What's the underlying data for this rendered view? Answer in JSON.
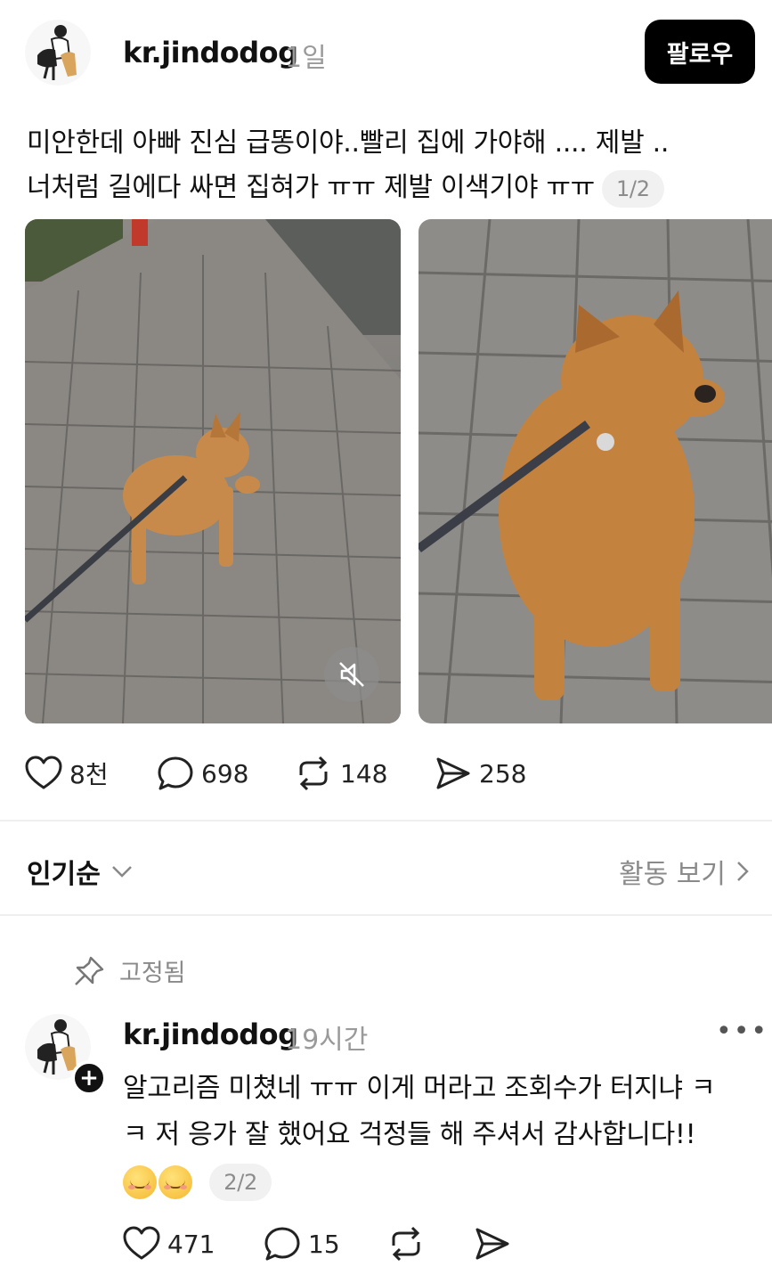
{
  "post": {
    "username": "kr.jindodog",
    "time": "1일",
    "follow_label": "팔로우",
    "text_line1": "미안한데 아빠 진심 급똥이야..빨리 집에 가야해 .... 제발 ..",
    "text_line2": "너처럼 길에다 싸면 집혀가 ㅠㅠ 제발 이색기야 ㅠㅠ",
    "counter": "1/2",
    "stats": {
      "likes": "8천",
      "comments": "698",
      "reposts": "148",
      "shares": "258"
    }
  },
  "replies_header": {
    "sort_label": "인기순",
    "activity_label": "활동 보기"
  },
  "comment": {
    "pinned_label": "고정됨",
    "username": "kr.jindodog",
    "time": "19시간",
    "more": "•••",
    "text_line1": "알고리즘 미쳤네 ㅠㅠ 이게 머라고 조회수가 터지냐 ㅋ",
    "text_line2": "ㅋ 저 응가 잘 했어요 걱정들 해 주셔서 감사합니다!!",
    "counter": "2/2",
    "stats": {
      "likes": "471",
      "comments": "15"
    }
  },
  "icons": {
    "like": "heart-icon",
    "comment": "speech-bubble-icon",
    "repost": "repost-icon",
    "share": "send-icon",
    "mute": "speaker-muted-icon",
    "pin": "pin-icon",
    "sort": "chevron-down-icon",
    "activity": "chevron-right-icon"
  },
  "colors": {
    "primary_text": "#111111",
    "secondary_text": "#9a9a9a",
    "follow_button_bg": "#000000",
    "badge_bg": "#f1f1f1"
  }
}
